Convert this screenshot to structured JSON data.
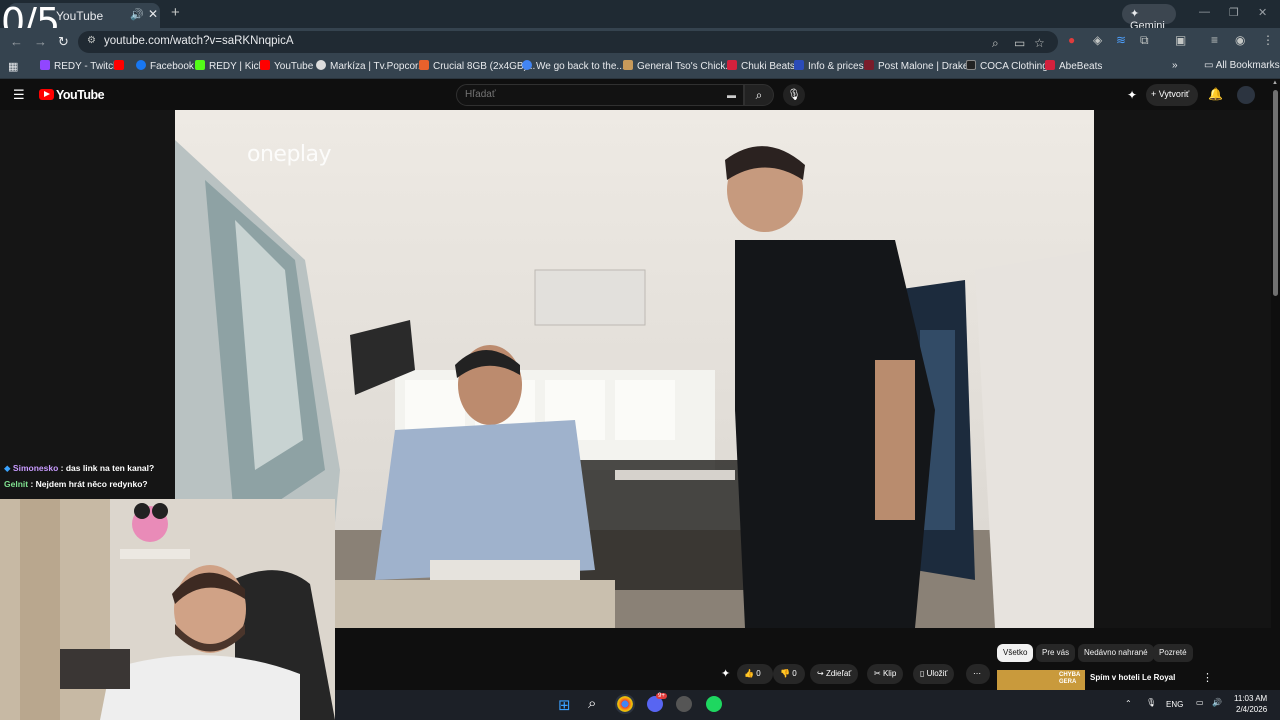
{
  "overlay": {
    "counter": "0/5"
  },
  "browser": {
    "tab": {
      "title": "YouTube"
    },
    "gemini_label": "Gemini",
    "url": "youtube.com/watch?v=saRKNnqpicA",
    "bookmarks": [
      {
        "label": "REDY - Twitch",
        "color": "#9146ff"
      },
      {
        "label": "",
        "color": "#ff0000"
      },
      {
        "label": "Facebook",
        "color": "#1877f2"
      },
      {
        "label": "REDY | Kick",
        "color": "#53fc18"
      },
      {
        "label": "YouTube",
        "color": "#ff0000"
      },
      {
        "label": "Markíza | Tv.Popcor...",
        "color": "#dddddd"
      },
      {
        "label": "Crucial 8GB (2x4GB)...",
        "color": "#e8612c"
      },
      {
        "label": "We go back to the...",
        "color": "#4285f4"
      },
      {
        "label": "General Tso's Chick...",
        "color": "#c89a5a"
      },
      {
        "label": "Chuki Beats",
        "color": "#d4213d"
      },
      {
        "label": "Info & prices",
        "color": "#2b4bb8"
      },
      {
        "label": "Post Malone | Drake...",
        "color": "#7a1c2a"
      },
      {
        "label": "COCA Clothing",
        "color": "#222222"
      },
      {
        "label": "AbeBeats",
        "color": "#d4213d"
      }
    ],
    "all_bookmarks": "All Bookmarks"
  },
  "youtube": {
    "logo_text": "YouTube",
    "search_placeholder": "Hľadať",
    "create_label": "Vytvoriť",
    "video_watermark": "oneplay",
    "actions": {
      "like_count": "0",
      "dislike_count": "0",
      "share": "Zdieľať",
      "clip": "Klip",
      "save": "Uložiť"
    },
    "chips": [
      "Všetko",
      "Pre vás",
      "Nedávno nahrané",
      "Pozreté"
    ],
    "recommended": {
      "title": "Spím v hoteli Le Royal",
      "thumb_text": "CHYBA GERA"
    }
  },
  "chat": [
    {
      "user": "Simonesko",
      "message": " : das link na ten kanal?",
      "color": "#c89bff"
    },
    {
      "user": "Gelnit",
      "message": " : Nejdem hrát něco redynko?",
      "color": "#7fe08f"
    }
  ],
  "taskbar": {
    "lang": "ENG",
    "time": "11:03 AM",
    "date": "2/4/2026",
    "discord_badge": "9+"
  }
}
